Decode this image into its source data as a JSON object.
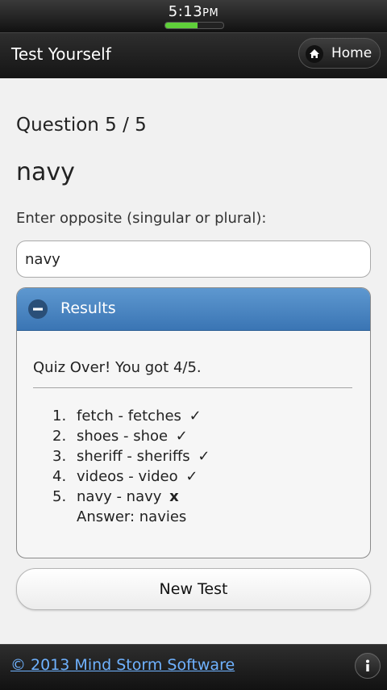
{
  "status_bar": {
    "time": "5:13",
    "time_suffix": "PM",
    "battery_level": 0.55
  },
  "header": {
    "title": "Test Yourself",
    "home_label": "Home"
  },
  "quiz": {
    "question_number": "Question 5 / 5",
    "word": "navy",
    "prompt": "Enter opposite (singular or plural):",
    "answer_value": "navy"
  },
  "results": {
    "title": "Results",
    "summary": "Quiz Over! You got 4/5.",
    "items": [
      {
        "num": "1.",
        "text": "fetch - fetches",
        "mark": "✓"
      },
      {
        "num": "2.",
        "text": "shoes - shoe",
        "mark": "✓"
      },
      {
        "num": "3.",
        "text": "sheriff - sheriffs",
        "mark": "✓"
      },
      {
        "num": "4.",
        "text": "videos - video",
        "mark": "✓"
      },
      {
        "num": "5.",
        "text": "navy - navy",
        "mark": "x"
      }
    ],
    "answer_note": "Answer: navies"
  },
  "new_test_label": "New Test",
  "footer": {
    "copyright": "© 2013 Mind Storm Software"
  },
  "colors": {
    "accent": "#3a75b4",
    "link": "#6fb2ff",
    "battery": "#5fcf3a"
  },
  "icons": {
    "home": "home-icon",
    "collapse": "minus-circle-icon",
    "info": "info-icon"
  }
}
